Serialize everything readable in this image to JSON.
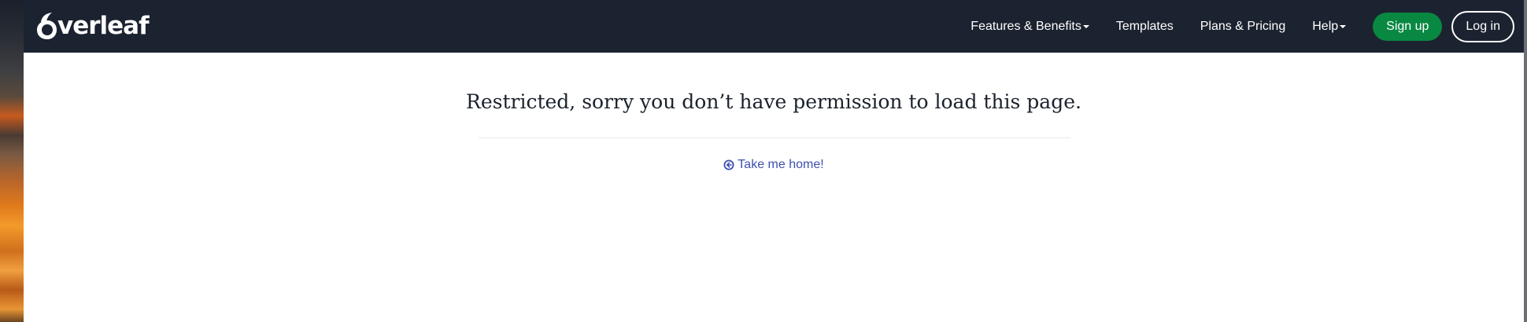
{
  "header": {
    "logo_text": "verleaf",
    "nav": [
      {
        "label": "Features & Benefits",
        "has_dropdown": true
      },
      {
        "label": "Templates",
        "has_dropdown": false
      },
      {
        "label": "Plans & Pricing",
        "has_dropdown": false
      },
      {
        "label": "Help",
        "has_dropdown": true
      }
    ],
    "signup_label": "Sign up",
    "login_label": "Log in"
  },
  "main": {
    "title": "Restricted, sorry you don’t have permission to load this page.",
    "home_link_label": "Take me home!",
    "home_link_icon": "arrow-circle-left-icon"
  },
  "colors": {
    "navbar_bg": "#1c2330",
    "signup_green": "#098842",
    "link_blue": "#3e4fb0"
  }
}
